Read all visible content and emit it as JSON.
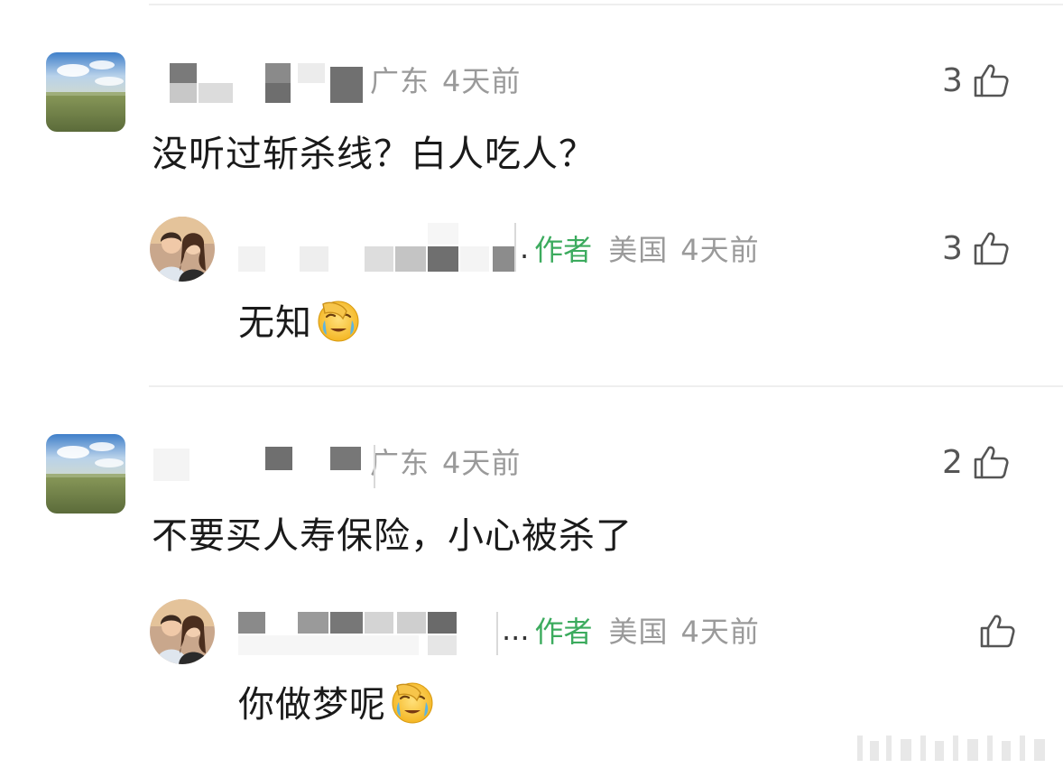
{
  "comments": [
    {
      "author_avatar": "landscape-avatar",
      "location": "广东",
      "time": "4天前",
      "likes": "3",
      "text": "没听过斩杀线？白人吃人？",
      "reply": {
        "author_avatar": "couple-avatar",
        "suffix": ".",
        "author_tag": "作者",
        "location": "美国",
        "time": "4天前",
        "likes": "3",
        "text": "无知",
        "emoji": "facepalm-crying-emoji"
      }
    },
    {
      "author_avatar": "landscape-avatar",
      "location": "广东",
      "time": "4天前",
      "likes": "2",
      "text": "不要买人寿保险，小心被杀了",
      "reply": {
        "author_avatar": "couple-avatar",
        "suffix": "...",
        "author_tag": "作者",
        "location": "美国",
        "time": "4天前",
        "likes": "",
        "text": "你做梦呢",
        "emoji": "facepalm-crying-emoji"
      }
    }
  ],
  "icons": {
    "like": "thumbs-up-icon"
  },
  "colors": {
    "author_tag": "#3cab5e",
    "meta": "#9a9a9a",
    "divider": "#eeeeee"
  }
}
